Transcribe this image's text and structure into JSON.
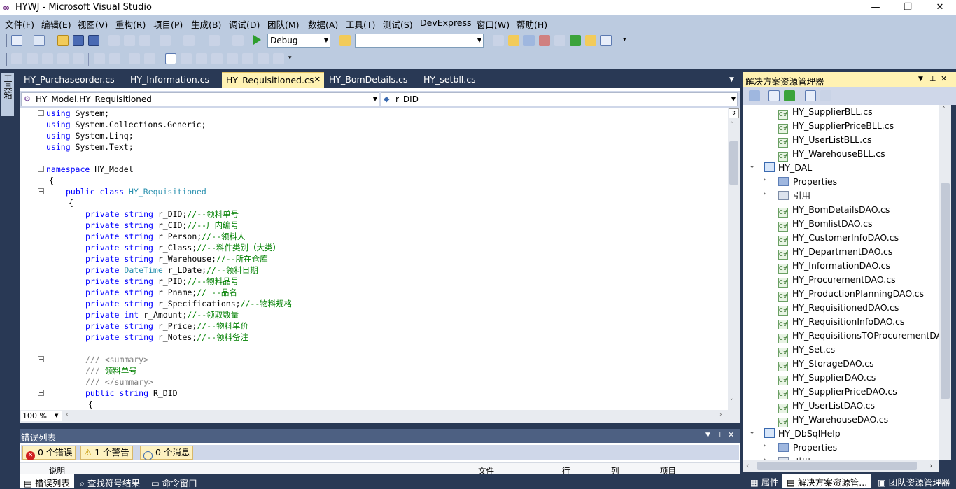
{
  "window": {
    "title": "HYWJ - Microsoft Visual Studio",
    "logo": "∞",
    "minimize": "—",
    "restore": "❐",
    "close": "✕"
  },
  "menu": [
    "文件(F)",
    "编辑(E)",
    "视图(V)",
    "重构(R)",
    "项目(P)",
    "生成(B)",
    "调试(D)",
    "团队(M)",
    "数据(A)",
    "工具(T)",
    "测试(S)",
    "DevExpress",
    "窗口(W)",
    "帮助(H)"
  ],
  "toolbar": {
    "config": "Debug",
    "find_value": ""
  },
  "toolbox_label": "工具箱",
  "tabs": [
    {
      "label": "HY_Purchaseorder.cs",
      "active": false
    },
    {
      "label": "HY_Information.cs",
      "active": false
    },
    {
      "label": "HY_Requisitioned.cs",
      "active": true,
      "close": "✕"
    },
    {
      "label": "HY_BomDetails.cs",
      "active": false
    },
    {
      "label": "HY_setbll.cs",
      "active": false
    }
  ],
  "navbar": {
    "type_combo": "HY_Model.HY_Requisitioned",
    "member_combo": "r_DID"
  },
  "code": {
    "using1": "System;",
    "using2": "System.Collections.Generic;",
    "using3": "System.Linq;",
    "using4": "System.Text;",
    "kw_using": "using",
    "kw_namespace": "namespace",
    "namespace_name": " HY_Model",
    "brace_open": "{",
    "kw_public_class": "public class ",
    "class_name": "HY_Requisitioned",
    "fields": [
      {
        "mod": "private ",
        "type": "string",
        "is_builtin": true,
        "name": " r_DID;",
        "comment": "//--领料单号"
      },
      {
        "mod": "private ",
        "type": "string",
        "is_builtin": true,
        "name": " r_CID;",
        "comment": "//--厂内编号"
      },
      {
        "mod": "private ",
        "type": "string",
        "is_builtin": true,
        "name": " r_Person;",
        "comment": "//--领料人"
      },
      {
        "mod": "private ",
        "type": "string",
        "is_builtin": true,
        "name": " r_Class;",
        "comment": "//--料件类别（大类）"
      },
      {
        "mod": "private ",
        "type": "string",
        "is_builtin": true,
        "name": " r_Warehouse;",
        "comment": "//--所在仓库"
      },
      {
        "mod": "private ",
        "type": "DateTime",
        "is_builtin": false,
        "name": " r_LDate;",
        "comment": "//--领料日期"
      },
      {
        "mod": "private ",
        "type": "string",
        "is_builtin": true,
        "name": " r_PID;",
        "comment": "//--物料品号"
      },
      {
        "mod": "private ",
        "type": "string",
        "is_builtin": true,
        "name": " r_Pname;",
        "comment": "// --品名"
      },
      {
        "mod": "private ",
        "type": "string",
        "is_builtin": true,
        "name": " r_Specifications;",
        "comment": "//--物料规格"
      },
      {
        "mod": "private ",
        "type": "int",
        "is_builtin": true,
        "name": " r_Amount;",
        "comment": "//--领取数量"
      },
      {
        "mod": "private ",
        "type": "string",
        "is_builtin": true,
        "name": " r_Price;",
        "comment": "//--物料单价"
      },
      {
        "mod": "private ",
        "type": "string",
        "is_builtin": true,
        "name": " r_Notes;",
        "comment": "//--领料备注"
      }
    ],
    "doc1_slashes": "///",
    "doc1_tag": " <summary>",
    "doc2_slashes": "///",
    "doc2_text": " 领料单号",
    "doc3_slashes": "///",
    "doc3_tag": " </summary>",
    "prop_kw": "public string",
    "prop_name": " R_DID",
    "prop_brace": "{"
  },
  "zoom": "100 %",
  "error_list": {
    "title": "错误列表",
    "errors": "0 个错误",
    "warnings": "1 个警告",
    "messages": "0 个消息",
    "columns": [
      "说明",
      "文件",
      "行",
      "列",
      "项目"
    ]
  },
  "bottom_tabs": [
    "错误列表",
    "查找符号结果",
    "命令窗口"
  ],
  "solution_explorer": {
    "title": "解决方案资源管理器",
    "items": [
      {
        "label": "HY_SupplierBLL.cs",
        "kind": "cs",
        "indent": 2
      },
      {
        "label": "HY_SupplierPriceBLL.cs",
        "kind": "cs",
        "indent": 2
      },
      {
        "label": "HY_UserListBLL.cs",
        "kind": "cs",
        "indent": 2
      },
      {
        "label": "HY_WarehouseBLL.cs",
        "kind": "cs",
        "indent": 2
      },
      {
        "label": "HY_DAL",
        "kind": "project",
        "indent": 1,
        "expander": "⌄"
      },
      {
        "label": "Properties",
        "kind": "folder",
        "indent": 2,
        "expander": "›"
      },
      {
        "label": "引用",
        "kind": "refs",
        "indent": 2,
        "expander": "›"
      },
      {
        "label": "HY_BomDetailsDAO.cs",
        "kind": "cs",
        "indent": 2
      },
      {
        "label": "HY_BomlistDAO.cs",
        "kind": "cs",
        "indent": 2
      },
      {
        "label": "HY_CustomerInfoDAO.cs",
        "kind": "cs",
        "indent": 2
      },
      {
        "label": "HY_DepartmentDAO.cs",
        "kind": "cs",
        "indent": 2
      },
      {
        "label": "HY_InformationDAO.cs",
        "kind": "cs",
        "indent": 2
      },
      {
        "label": "HY_ProcurementDAO.cs",
        "kind": "cs",
        "indent": 2
      },
      {
        "label": "HY_ProductionPlanningDAO.cs",
        "kind": "cs",
        "indent": 2
      },
      {
        "label": "HY_RequisitionedDAO.cs",
        "kind": "cs",
        "indent": 2
      },
      {
        "label": "HY_RequisitionInfoDAO.cs",
        "kind": "cs",
        "indent": 2
      },
      {
        "label": "HY_RequisitionsTOProcurementDAO",
        "kind": "cs",
        "indent": 2
      },
      {
        "label": "HY_Set.cs",
        "kind": "cs",
        "indent": 2
      },
      {
        "label": "HY_StorageDAO.cs",
        "kind": "cs",
        "indent": 2
      },
      {
        "label": "HY_SupplierDAO.cs",
        "kind": "cs",
        "indent": 2
      },
      {
        "label": "HY_SupplierPriceDAO.cs",
        "kind": "cs",
        "indent": 2
      },
      {
        "label": "HY_UserListDAO.cs",
        "kind": "cs",
        "indent": 2
      },
      {
        "label": "HY_WarehouseDAO.cs",
        "kind": "cs",
        "indent": 2
      },
      {
        "label": "HY_DbSqlHelp",
        "kind": "project",
        "indent": 1,
        "expander": "⌄"
      },
      {
        "label": "Properties",
        "kind": "folder",
        "indent": 2,
        "expander": "›"
      },
      {
        "label": "引用",
        "kind": "refs",
        "indent": 2,
        "expander": "›"
      }
    ],
    "bottom_tabs": [
      "属性",
      "解决方案资源管...",
      "团队资源管理器"
    ]
  }
}
